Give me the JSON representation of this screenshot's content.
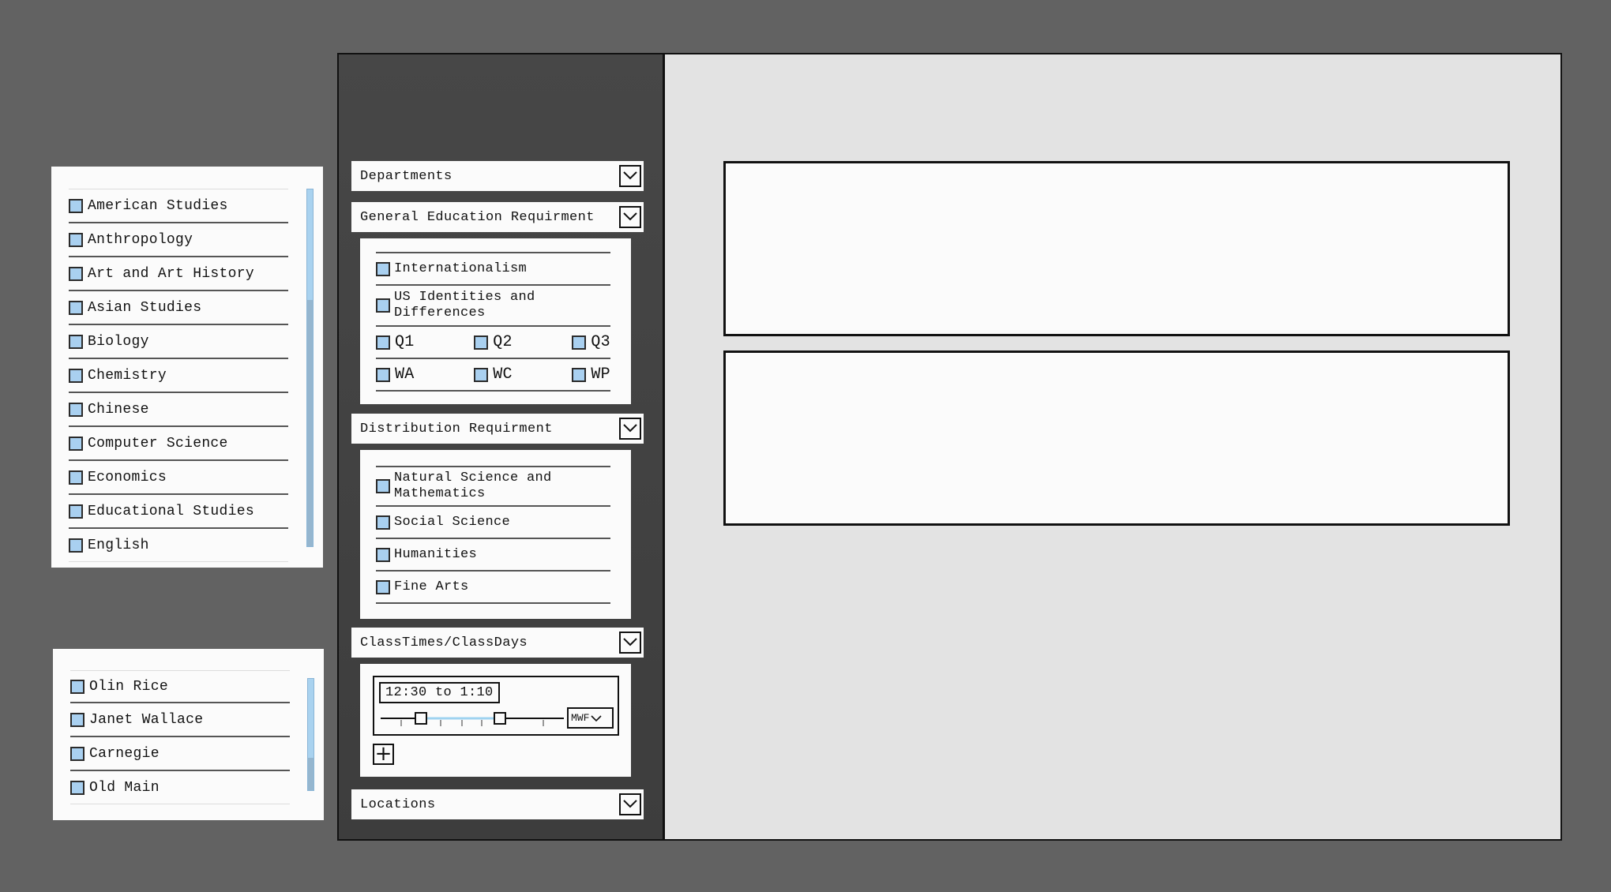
{
  "departments_popup": {
    "items": [
      "American Studies",
      "Anthropology",
      "Art and Art History",
      "Asian Studies",
      "Biology",
      "Chemistry",
      "Chinese",
      "Computer Science",
      "Economics",
      "Educational Studies",
      "English"
    ]
  },
  "locations_popup": {
    "items": [
      "Olin Rice",
      "Janet Wallace",
      "Carnegie",
      "Old Main"
    ]
  },
  "sidebar": {
    "departments_header": "Departments",
    "gen_ed_header": "General Education Requirment",
    "gen_ed": {
      "internationalism": "Internationalism",
      "us_identities": "US Identities and Differences",
      "q_options": [
        "Q1",
        "Q2",
        "Q3"
      ],
      "w_options": [
        "WA",
        "WC",
        "WP"
      ]
    },
    "distribution_header": "Distribution Requirment",
    "distribution": {
      "items": [
        "Natural Science and Mathematics",
        "Social Science",
        "Humanities",
        "Fine Arts"
      ]
    },
    "classtimes_header": "ClassTimes/ClassDays",
    "classtimes": {
      "range_label": "12:30 to 1:10",
      "days_selected": "MWF",
      "add_symbol": "+"
    },
    "locations_header": "Locations"
  },
  "colors": {
    "background": "#626262",
    "sidebar": "#444444",
    "content": "#e3e3e3",
    "checkbox_fill": "#a9d0f0",
    "slider_accent": "#9fd3f0"
  }
}
